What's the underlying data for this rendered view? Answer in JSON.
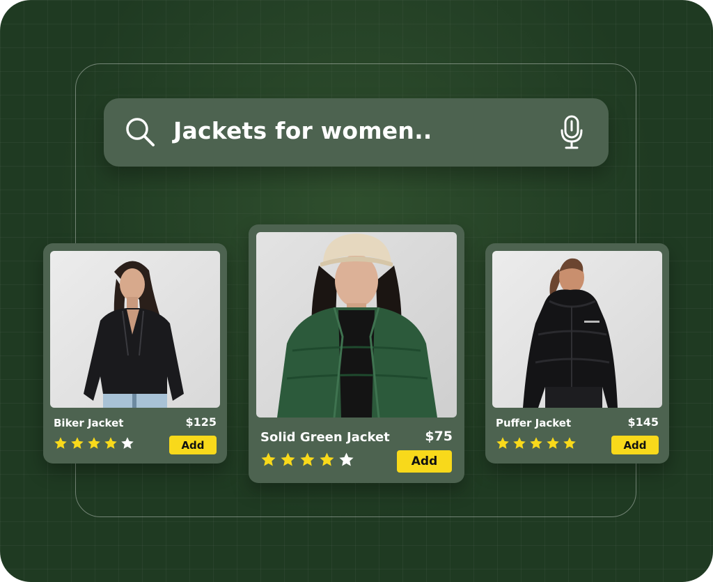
{
  "search": {
    "query": "Jackets for women..",
    "search_icon": "search-icon",
    "voice_icon": "microphone-icon"
  },
  "products": [
    {
      "name": "Biker Jacket",
      "price": "$125",
      "rating": 4,
      "max_rating": 5,
      "add_label": "Add",
      "image": "woman-black-leather-biker-jacket"
    },
    {
      "name": "Solid Green Jacket",
      "price": "$75",
      "rating": 4,
      "max_rating": 5,
      "add_label": "Add",
      "image": "woman-green-puffer-jacket-cap"
    },
    {
      "name": "Puffer Jacket",
      "price": "$145",
      "rating": 5,
      "max_rating": 5,
      "add_label": "Add",
      "image": "woman-black-hooded-puffer-jacket"
    }
  ],
  "colors": {
    "background": "#1f3a22",
    "card": "#4d6350",
    "accent": "#f8d91b",
    "star_filled": "#f8d91b",
    "star_empty": "#ffffff"
  }
}
